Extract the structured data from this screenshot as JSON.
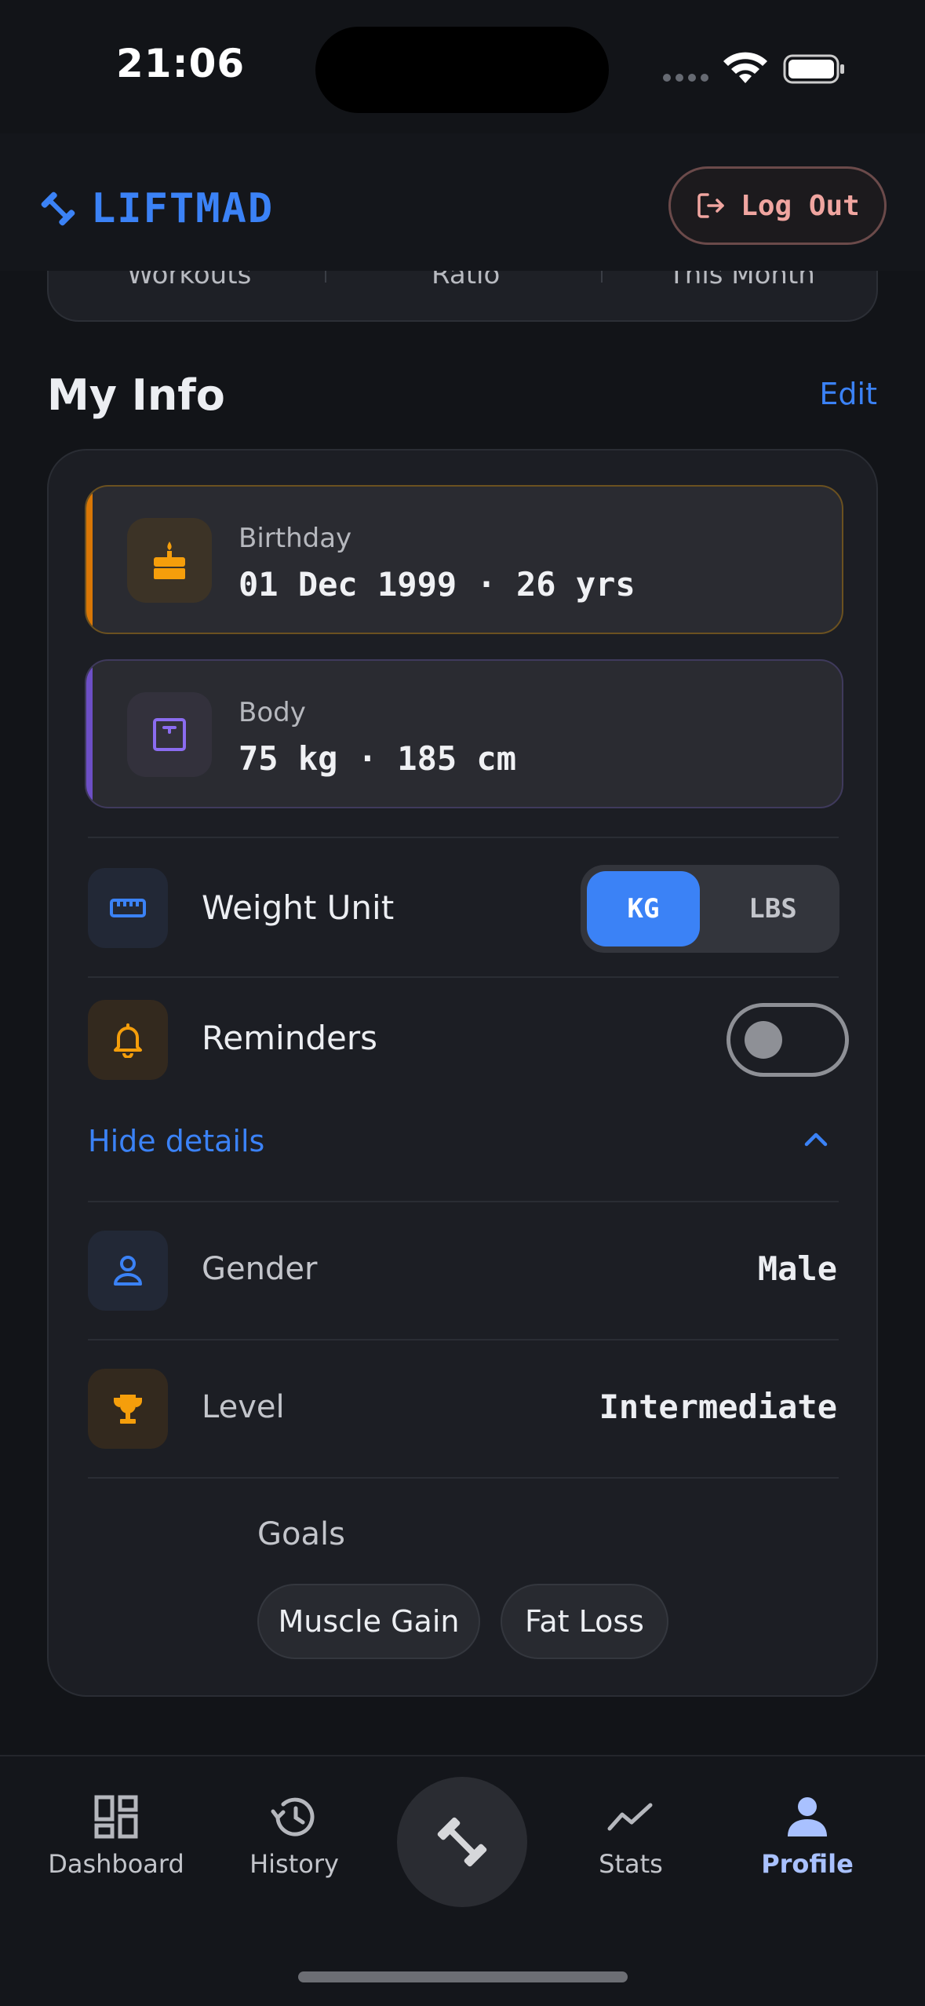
{
  "status_bar": {
    "time": "21:06"
  },
  "header": {
    "brand": "LIFTMAD",
    "logout_label": "Log Out"
  },
  "stats_strip": {
    "labels": [
      "Workouts",
      "Ratio",
      "This Month"
    ]
  },
  "my_info": {
    "title": "My Info",
    "edit_label": "Edit",
    "birthday": {
      "label": "Birthday",
      "value": "01 Dec 1999 · 26 yrs"
    },
    "body": {
      "label": "Body",
      "value": "75 kg · 185 cm"
    },
    "weight_unit": {
      "label": "Weight Unit",
      "options": [
        "KG",
        "LBS"
      ],
      "selected": "KG"
    },
    "reminders": {
      "label": "Reminders",
      "enabled": false
    },
    "toggle_details_label": "Hide details",
    "gender": {
      "label": "Gender",
      "value": "Male"
    },
    "level": {
      "label": "Level",
      "value": "Intermediate"
    },
    "goals": {
      "label": "Goals",
      "items": [
        "Muscle Gain",
        "Fat Loss"
      ]
    }
  },
  "nav": {
    "items": [
      {
        "label": "Dashboard",
        "icon": "dashboard-icon"
      },
      {
        "label": "History",
        "icon": "history-icon"
      },
      {
        "label": "Stats",
        "icon": "stats-icon"
      },
      {
        "label": "Profile",
        "icon": "profile-icon",
        "active": true
      }
    ],
    "center_icon": "dumbbell-icon"
  },
  "colors": {
    "accent": "#3b82f6",
    "birthday_accent": "#d97706",
    "body_accent": "#7c5cd6",
    "logout_text": "#f0a5a0",
    "background": "#121418"
  }
}
